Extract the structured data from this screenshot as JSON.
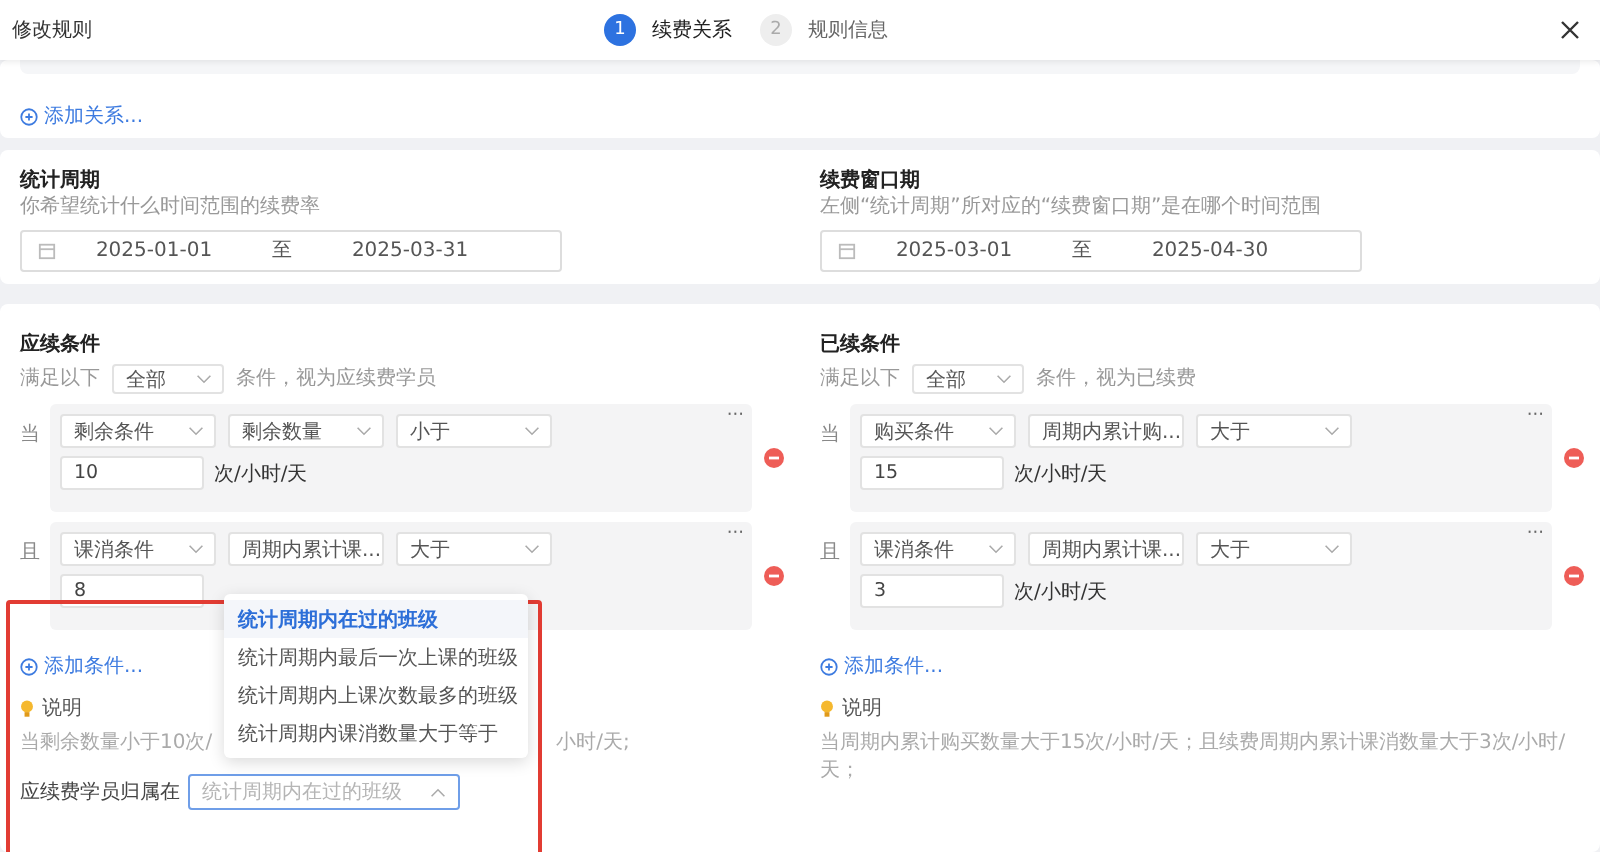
{
  "dialog": {
    "title": "修改规则"
  },
  "steps": [
    {
      "number": "1",
      "label": "续费关系",
      "selected": true
    },
    {
      "number": "2",
      "label": "规则信息",
      "selected": false
    }
  ],
  "relations": {
    "add_link": "添加关系..."
  },
  "periods": [
    {
      "title": "统计周期",
      "hint": "你希望统计什么时间范围的续费率",
      "start": "2025-01-01",
      "separator": "至",
      "end": "2025-03-31"
    },
    {
      "title": "续费窗口期",
      "hint": "左侧“统计周期”所对应的“续费窗口期”是在哪个时间范围",
      "start": "2025-03-01",
      "separator": "至",
      "end": "2025-04-30"
    }
  ],
  "condition_groups": [
    {
      "title": "应续条件",
      "prefix": "满足以下",
      "match": "全部",
      "suffix": "条件，视为应续费学员",
      "conditions": [
        {
          "connector": "当",
          "fields": [
            "剩余条件",
            "剩余数量",
            "小于"
          ],
          "value": "10",
          "unit": "次/小时/天",
          "more": "···"
        },
        {
          "connector": "且",
          "fields": [
            "课消条件",
            "周期内累计课...",
            "大于"
          ],
          "value": "8",
          "more": "···"
        }
      ],
      "add_link": "添加条件...",
      "note_title": "说明",
      "note_parts": [
        "当剩余数量小于10次/",
        "小时/天;"
      ]
    },
    {
      "title": "已续条件",
      "prefix": "满足以下",
      "match": "全部",
      "suffix": "条件，视为已续费",
      "conditions": [
        {
          "connector": "当",
          "fields": [
            "购买条件",
            "周期内累计购...",
            "大于"
          ],
          "value": "15",
          "unit": "次/小时/天",
          "more": "···"
        },
        {
          "connector": "且",
          "fields": [
            "课消条件",
            "周期内累计课...",
            "大于"
          ],
          "value": "3",
          "unit": "次/小时/天",
          "more": "···"
        }
      ],
      "add_link": "添加条件...",
      "note_title": "说明",
      "note_parts": [
        "当周期内累计购买数量大于15次/小时/天；且续费周期内累计课消数量大于3次/小时/天；"
      ]
    }
  ],
  "ownership": {
    "label": "应续费学员归属在",
    "placeholder": "统计周期内在过的班级",
    "expanded": true,
    "options": [
      {
        "label": "统计周期内在过的班级",
        "selected": true
      },
      {
        "label": "统计周期内最后一次上课的班级",
        "selected": false
      },
      {
        "label": "统计周期内上课次数最多的班级",
        "selected": false
      },
      {
        "label": "统计周期内课消数量大于等于",
        "selected": false
      }
    ]
  }
}
